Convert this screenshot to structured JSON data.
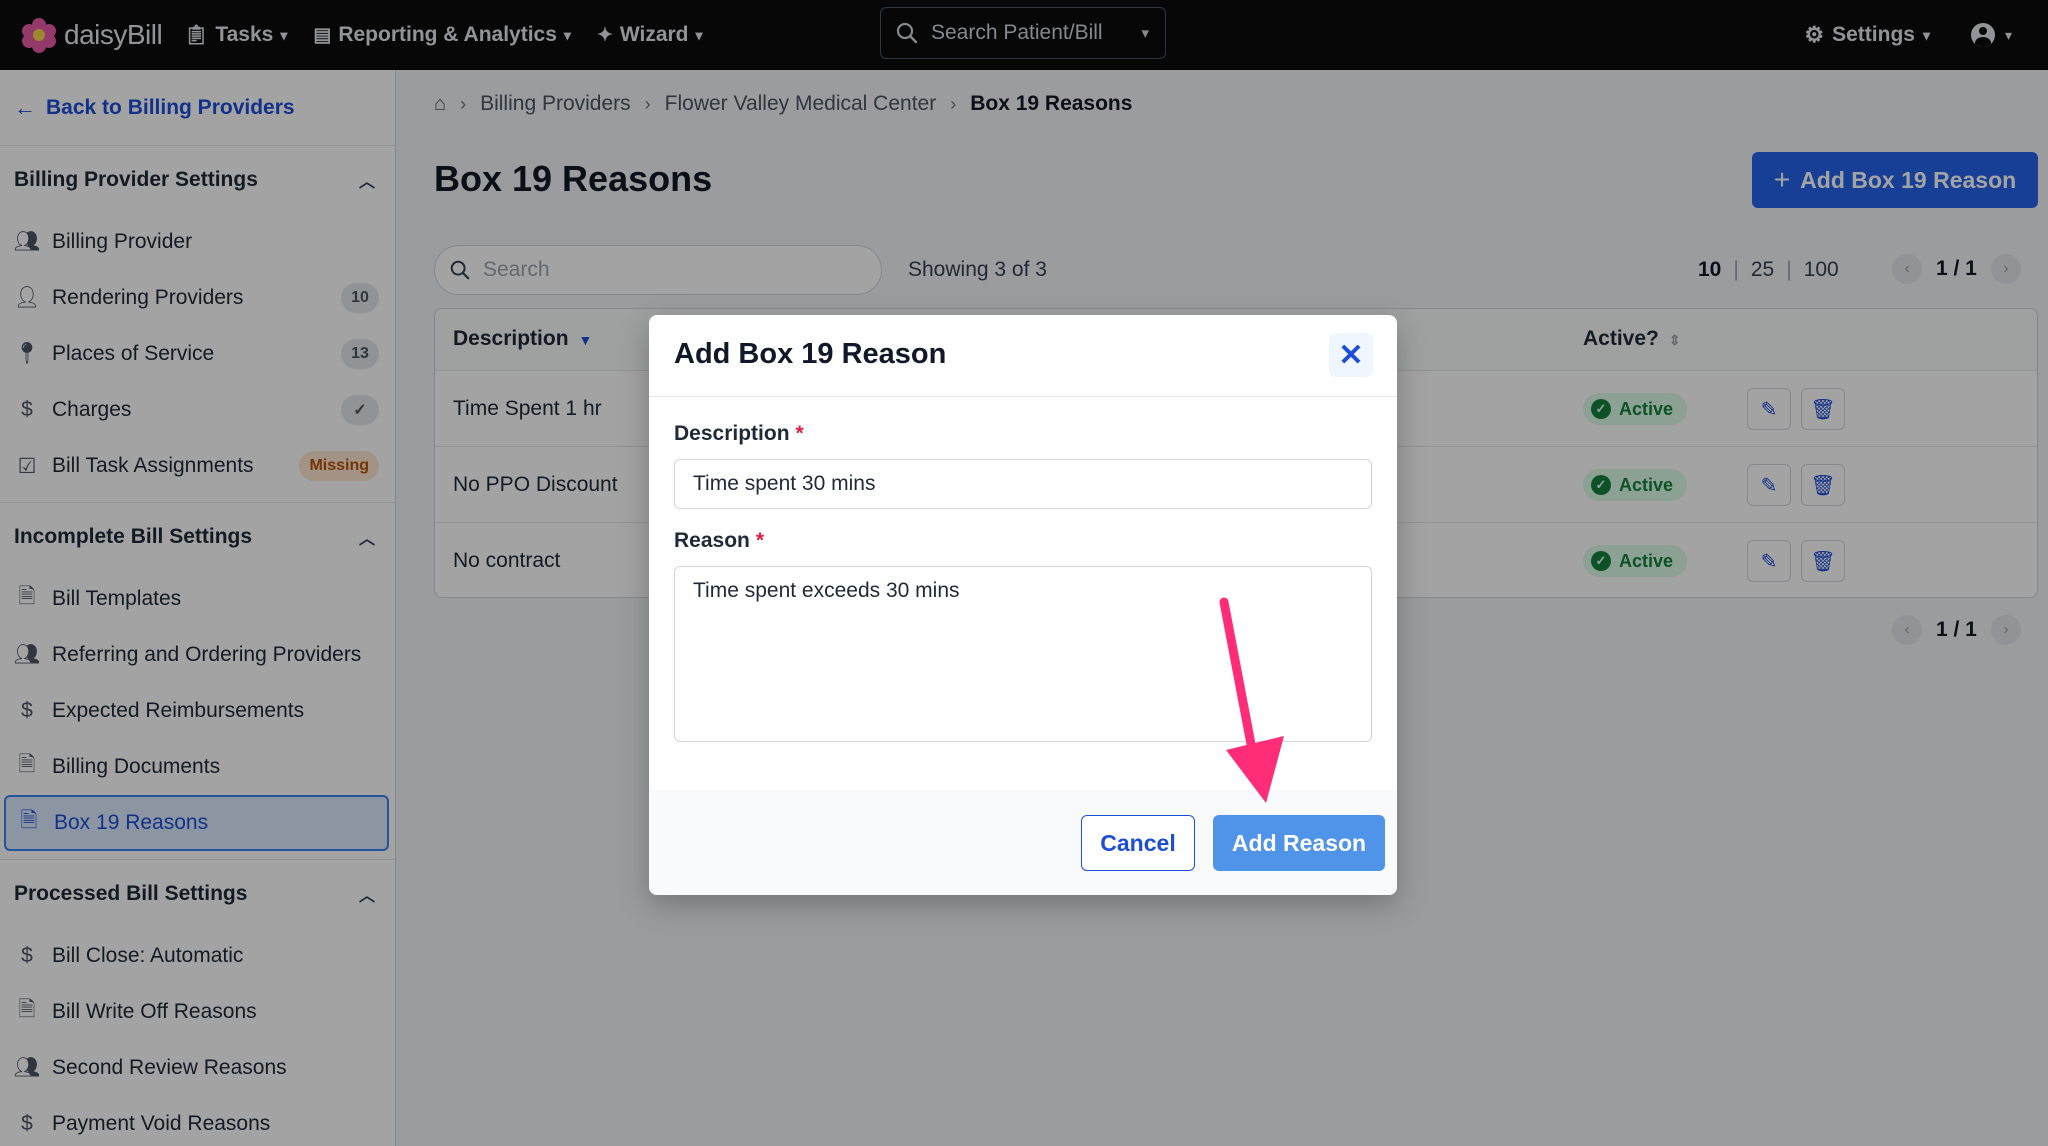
{
  "app": {
    "logo_text": "daisyBill",
    "nav": [
      {
        "label": "Tasks",
        "icon": "clipboard-icon"
      },
      {
        "label": "Reporting & Analytics",
        "icon": "chart-icon"
      },
      {
        "label": "Wizard",
        "icon": "wand-icon"
      }
    ],
    "search_label": "Search Patient/Bill",
    "settings_label": "Settings"
  },
  "sidebar": {
    "back_label": "Back to Billing Providers",
    "sections": [
      {
        "title": "Billing Provider Settings",
        "items": [
          {
            "label": "Billing Provider",
            "icon": "users-icon",
            "badge": ""
          },
          {
            "label": "Rendering Providers",
            "icon": "user-id-icon",
            "badge": "10"
          },
          {
            "label": "Places of Service",
            "icon": "map-pin-icon",
            "badge": "13"
          },
          {
            "label": "Charges",
            "icon": "dollar-icon",
            "badge": "✓"
          },
          {
            "label": "Bill Task Assignments",
            "icon": "clipboard-check-icon",
            "badge": "Missing"
          }
        ]
      },
      {
        "title": "Incomplete Bill Settings",
        "items": [
          {
            "label": "Bill Templates",
            "icon": "document-icon"
          },
          {
            "label": "Referring and Ordering Providers",
            "icon": "users-icon"
          },
          {
            "label": "Expected Reimbursements",
            "icon": "dollar-icon"
          },
          {
            "label": "Billing Documents",
            "icon": "document-icon"
          },
          {
            "label": "Box 19 Reasons",
            "icon": "document-icon",
            "active": true
          }
        ]
      },
      {
        "title": "Processed Bill Settings",
        "items": [
          {
            "label": "Bill Close: Automatic",
            "icon": "dollar-icon"
          },
          {
            "label": "Bill Write Off Reasons",
            "icon": "document-icon"
          },
          {
            "label": "Second Review Reasons",
            "icon": "users-icon"
          },
          {
            "label": "Payment Void Reasons",
            "icon": "dollar-icon"
          }
        ]
      }
    ]
  },
  "main": {
    "breadcrumb": [
      "Billing Providers",
      "Flower Valley Medical Center",
      "Box 19 Reasons"
    ],
    "title": "Box 19 Reasons",
    "add_button_label": "Add Box 19 Reason",
    "search_placeholder": "Search",
    "showing_text": "Showing 3 of 3",
    "page_sizes": [
      "10",
      "25",
      "100"
    ],
    "page_indicator": "1 / 1",
    "columns": {
      "description": "Description",
      "active": "Active?"
    },
    "rows": [
      {
        "description": "Time Spent 1 hr",
        "status": "Active"
      },
      {
        "description": "No PPO Discount",
        "status": "Active"
      },
      {
        "description": "No contract",
        "status": "Active"
      }
    ]
  },
  "modal": {
    "title": "Add Box 19 Reason",
    "description_label": "Description",
    "description_value": "Time spent 30 mins",
    "reason_label": "Reason",
    "reason_value": "Time spent exceeds 30 mins",
    "required_mark": "*",
    "cancel_label": "Cancel",
    "submit_label": "Add Reason"
  },
  "colors": {
    "primary": "#2563eb",
    "topbar": "#0b0b0b",
    "active_badge": "#15803d",
    "annotation_arrow": "#ff2d78"
  }
}
